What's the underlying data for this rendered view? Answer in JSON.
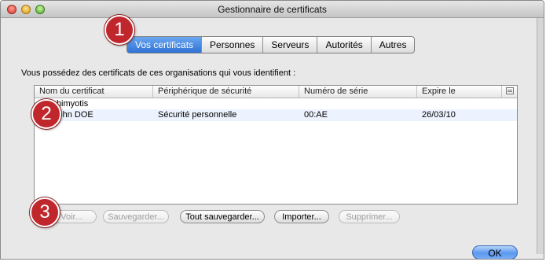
{
  "window": {
    "title": "Gestionnaire de certificats"
  },
  "tabs": [
    "Vos certificats",
    "Personnes",
    "Serveurs",
    "Autorités",
    "Autres"
  ],
  "description": "Vous possédez des certificats de ces organisations qui vous identifient :",
  "table": {
    "columns": [
      "Nom du certificat",
      "Périphérique de sécurité",
      "Numéro de série",
      "Expire le"
    ],
    "organization": "Dhimyotis",
    "rows": [
      {
        "name": "John DOE",
        "device": "Sécurité personnelle",
        "serial": "00:AE",
        "expires": "26/03/10"
      }
    ]
  },
  "buttons": {
    "view": "Voir...",
    "backup": "Sauvegarder...",
    "backup_all": "Tout sauvegarder...",
    "import": "Importer...",
    "delete": "Supprimer...",
    "ok": "OK"
  },
  "annotations": [
    "1",
    "2",
    "3"
  ],
  "colors": {
    "annotation": "#c0272d",
    "active_tab": "#2f72d6",
    "selected_row": "#edf3fe"
  }
}
